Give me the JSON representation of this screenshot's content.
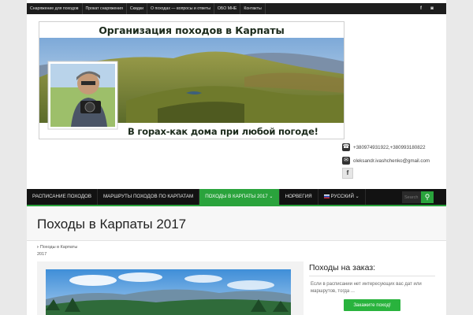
{
  "topnav": {
    "items": [
      "Снаряжение для походов",
      "Прокат снаряжения",
      "Скидки",
      "О походах — вопросы и ответы",
      "ОБО МНЕ",
      "Контакты"
    ],
    "social_icons": [
      "facebook-icon",
      "rss-icon"
    ]
  },
  "banner": {
    "title": "Организация походов в Карпаты",
    "subtitle": "В горах-как дома при любой погоде!"
  },
  "contacts": {
    "phone": "+380974931922,+380993180822",
    "email": "oleksandr.ivashchenko@gmail.com",
    "facebook": "f"
  },
  "mainnav": {
    "items": [
      "РАСПИСАНИЕ ПОХОДОВ",
      "МАРШРУТЫ ПОХОДОВ ПО КАРПАТАМ",
      "ПОХОДЫ В КАРПАТЫ 2017 ⌄",
      "НОРВЕГИЯ",
      "РУССКИЙ ⌄"
    ],
    "active_index": 2,
    "search_placeholder": "Search"
  },
  "page": {
    "title": "Походы в Карпаты 2017",
    "breadcrumb": [
      "Походы в Карпаты",
      "2017"
    ]
  },
  "sidebar": {
    "title": "Походы на заказ:",
    "text": "Если в расписании нет интересующих вас дат или маршрутов, тогда ...",
    "button": "Закажите поход!"
  },
  "colors": {
    "accent": "#2aa33c",
    "topbar": "#1d1d1d",
    "nav": "#121212"
  }
}
